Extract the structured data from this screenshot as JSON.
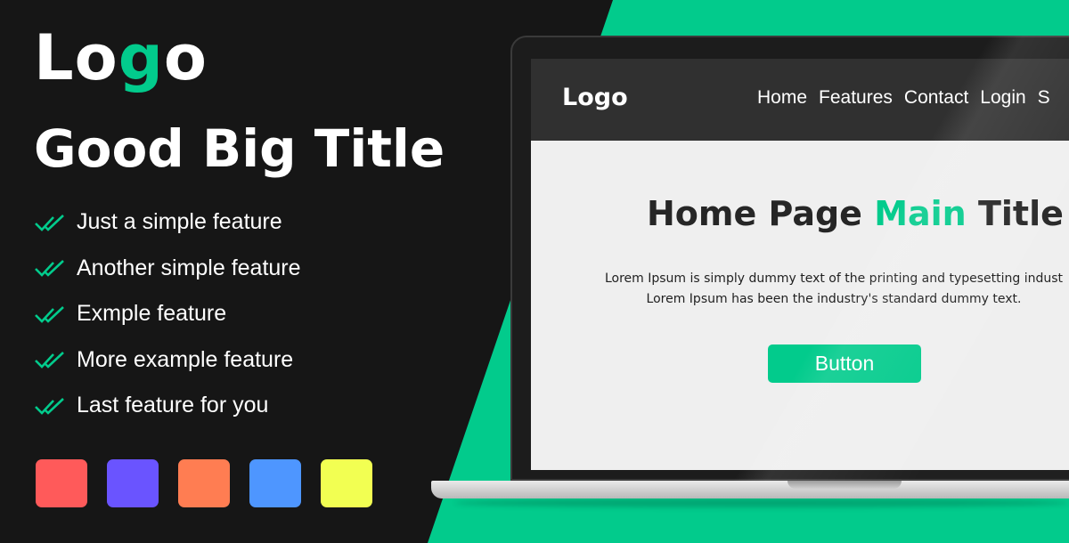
{
  "brand": {
    "logo_prefix": "Lo",
    "logo_accent": "g",
    "logo_suffix": "o"
  },
  "headline": "Good Big Title",
  "features": [
    "Just a simple feature",
    "Another simple feature",
    "Exmple feature",
    "More example feature",
    "Last feature for you"
  ],
  "icons": {
    "feature_bullet": "double-check-icon"
  },
  "swatches": [
    "#FF5A5A",
    "#6A54FF",
    "#FF7D52",
    "#4E96FF",
    "#F2FF52"
  ],
  "colors": {
    "accent": "#02CB8C",
    "dark": "#161616"
  },
  "screen": {
    "logo": "Logo",
    "nav": [
      "Home",
      "Features",
      "Contact",
      "Login",
      "S"
    ],
    "title_before": "Home Page ",
    "title_accent": "Main",
    "title_after": " Title",
    "body_line1": "Lorem Ipsum is simply dummy text of the printing and typesetting indust",
    "body_line2": "Lorem Ipsum has been the industry's standard dummy text.",
    "button": "Button"
  }
}
